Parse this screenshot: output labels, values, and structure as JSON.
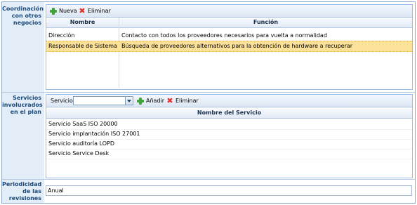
{
  "coordinacion": {
    "label_lines": [
      "Coordinación",
      "con otros",
      "negocios"
    ],
    "nueva_label": "Nueva",
    "eliminar_label": "Eliminar",
    "columns": [
      "Nombre",
      "Función"
    ],
    "rows": [
      {
        "nombre": "Dirección",
        "funcion": "Contacto con todos los proveedores necesarios para vuelta a normalidad",
        "selected": false
      },
      {
        "nombre": "Responsable de Sistemas",
        "funcion": "Búsqueda de proveedores alternativos para la obtención de hardware a recuperar",
        "selected": true
      }
    ]
  },
  "servicios": {
    "label_lines": [
      "Servicios",
      "involucrados",
      "en el plan"
    ],
    "select_label": "Servicios",
    "select_value": "",
    "anadir_label": "Añadir",
    "eliminar_label": "Eliminar",
    "column": "Nombre del Servicio",
    "rows": [
      "Servicio SaaS ISO 20000",
      "Servicio implantación ISO 27001",
      "Servicio auditoría LOPD",
      "Servicio Service Desk"
    ]
  },
  "periodicidad": {
    "label_lines": [
      "Periodicidad",
      "de las",
      "revisiones"
    ],
    "value": "Anual"
  },
  "colors": {
    "label_bg": "#e3edf8",
    "label_text": "#1b4a7a",
    "selected_row": "#fbe19a",
    "add_green": "#3fa33a",
    "delete_red": "#e0312b"
  }
}
